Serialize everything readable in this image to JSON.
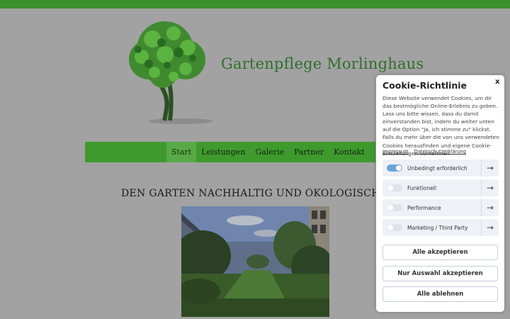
{
  "site": {
    "title": "Gartenpflege Morlinghaus",
    "headline": "DEN GARTEN NACHHALTIG UND ÖKOLOGISCH PFLEGEN"
  },
  "nav": {
    "items": [
      {
        "label": "Start",
        "active": true
      },
      {
        "label": "Leistungen",
        "active": false
      },
      {
        "label": "Galerie",
        "active": false
      },
      {
        "label": "Partner",
        "active": false
      },
      {
        "label": "Kontakt",
        "active": false
      }
    ]
  },
  "cookie": {
    "title": "Cookie-Richtlinie",
    "close": "x",
    "text": "Diese Website verwendet Cookies, um dir das bestmögliche Online-Erlebnis zu geben. Lass uns bitte wissen, dass du damit einverstanden bist, indem du weiter unten auf die Option \"Ja, ich stimme zu\" klickst. Falls du mehr über die von uns verwendeten Cookies herausfinden und eigene Cookie-Einstellungen vornehmen",
    "links": {
      "impressum": "Impressum",
      "datenschutz": "Datenschutzerklärung"
    },
    "categories": [
      {
        "label": "Unbedingt erforderlich",
        "enabled": true
      },
      {
        "label": "Funktionell",
        "enabled": false
      },
      {
        "label": "Performance",
        "enabled": false
      },
      {
        "label": "Marketing / Third Party",
        "enabled": false
      }
    ],
    "arrow_icon": "arrow-right-icon",
    "buttons": {
      "accept_all": "Alle akzeptieren",
      "accept_selection": "Nur Auswahl akzeptieren",
      "reject_all": "Alle ablehnen"
    }
  },
  "colors": {
    "green_brand": "#3f9a2e",
    "toggle_on": "#6aa7d6"
  }
}
